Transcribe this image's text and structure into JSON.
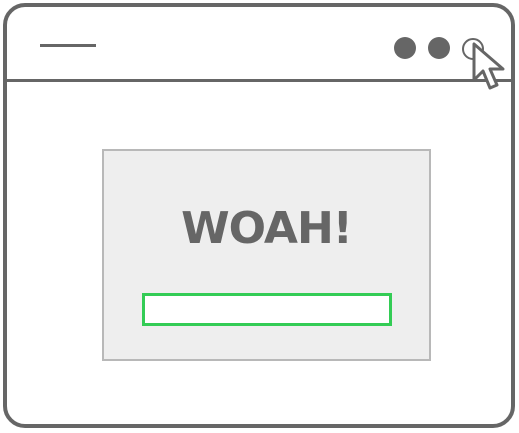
{
  "window": {
    "menu_icon": "hamburger-line-icon",
    "controls": [
      {
        "name": "window-dot-1",
        "style": "filled"
      },
      {
        "name": "window-dot-2",
        "style": "filled"
      },
      {
        "name": "window-dot-3",
        "style": "outline"
      }
    ],
    "cursor_icon": "mouse-pointer-icon"
  },
  "dialog": {
    "title": "WOAH!",
    "input_value": "",
    "input_border_color": "#33cc55"
  },
  "colors": {
    "frame": "#666666",
    "dialog_bg": "#eeeeee",
    "dialog_border": "#b8b8b8",
    "accent": "#33cc55"
  }
}
